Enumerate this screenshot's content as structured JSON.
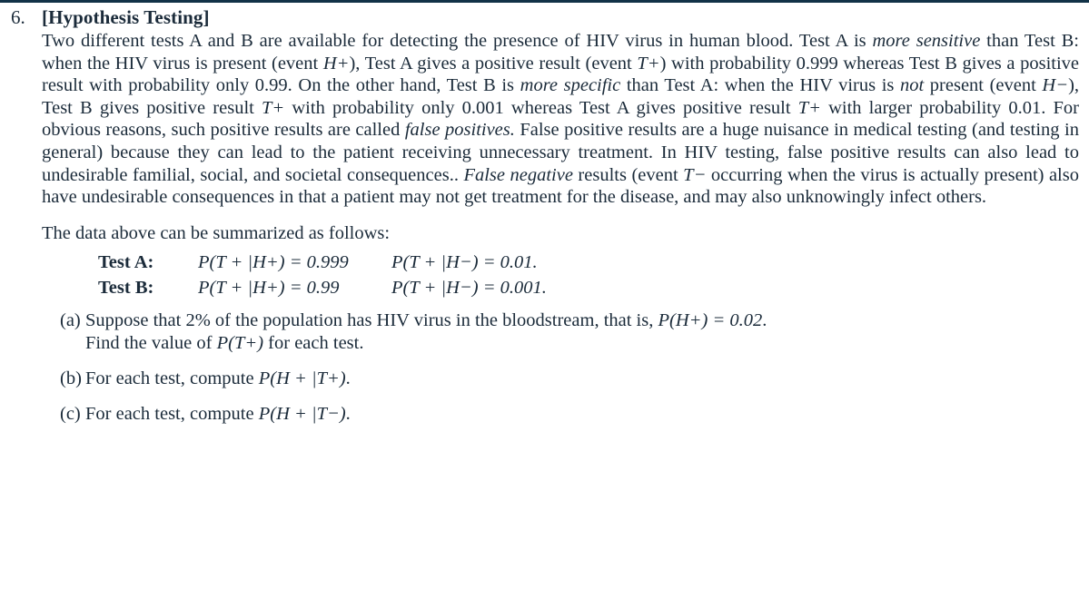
{
  "page": {
    "rule_color": "#123247",
    "text_color": "#1b2b3a",
    "background": "#ffffff"
  },
  "problem": {
    "number": "6.",
    "title": "[Hypothesis Testing]",
    "paragraph_1": {
      "s1": "Two different tests A and B are available for detecting the presence of HIV virus in human blood. Test A is ",
      "em1": "more sensitive",
      "s2": " than Test B: when the HIV virus is present (event ",
      "math1": "H+",
      "s3": "), Test A gives a positive result (event ",
      "math2": "T+",
      "s4": ") with probability 0.999 whereas Test B gives a positive result with probability only 0.99. On the other hand, Test B is ",
      "em2": "more specific",
      "s5": " than Test A: when the HIV virus is ",
      "em3": "not",
      "s6": " present (event ",
      "math3": "H−",
      "s7": "), Test B gives positive result ",
      "math4": "T+",
      "s8": " with probability only 0.001 whereas Test A gives positive result ",
      "math5": "T+",
      "s9": " with larger probability 0.01. For obvious reasons, such positive results are called ",
      "em4": "false positives.",
      "s10": " False positive results are a huge nuisance in medical testing (and testing in general) because they can lead to the patient receiving unnecessary treatment. In HIV testing, false positive results can also lead to undesirable familial, social, and societal consequences.. ",
      "em5": "False negative",
      "s11": " results (event ",
      "math6": "T−",
      "s12": " occurring when the virus is actually present) also have undesirable consequences in that a patient may not get treatment for the disease, and may also unknowingly infect others."
    },
    "summary_intro": "The data above can be summarized as follows:",
    "summary_rows": [
      {
        "label": "Test A:",
        "cell_a": "P(T + |H+) = 0.999",
        "cell_b": "P(T + |H−) = 0.01."
      },
      {
        "label": "Test B:",
        "cell_a": "P(T + |H+) = 0.99",
        "cell_b": "P(T + |H−) = 0.001."
      }
    ],
    "parts": [
      {
        "label": "(a)",
        "line1_s1": "Suppose that 2% of the population has HIV virus in the bloodstream, that is, ",
        "line1_math": "P(H+) = 0.02",
        "line1_s2": ".",
        "line2_s1": "Find the value of ",
        "line2_math": "P(T+)",
        "line2_s2": " for each test."
      },
      {
        "label": "(b)",
        "line1_s1": "For each test, compute ",
        "line1_math": "P(H + |T+)",
        "line1_s2": "."
      },
      {
        "label": "(c)",
        "line1_s1": "For each test, compute ",
        "line1_math": "P(H + |T−)",
        "line1_s2": "."
      }
    ]
  }
}
